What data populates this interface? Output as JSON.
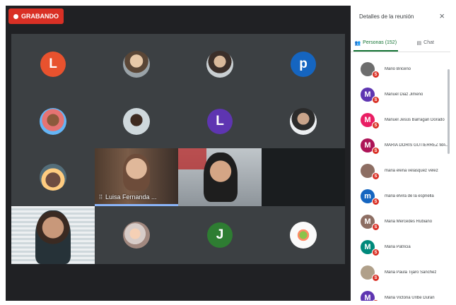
{
  "recording_label": "GRABANDO",
  "colors": {
    "accent_green": "#137333",
    "recording_red": "#d93025"
  },
  "grid": {
    "row1": [
      {
        "type": "letter",
        "letter": "L",
        "color": "#e8522e"
      },
      {
        "type": "photo",
        "icon": "person-photo"
      },
      {
        "type": "photo",
        "icon": "person-photo"
      },
      {
        "type": "letter",
        "letter": "p",
        "color": "#1565c0"
      }
    ],
    "row2": [
      {
        "type": "photo",
        "icon": "person-photo"
      },
      {
        "type": "photo",
        "icon": "person-photo"
      },
      {
        "type": "letter",
        "letter": "L",
        "color": "#5e35b1"
      },
      {
        "type": "photo",
        "icon": "person-photo"
      }
    ],
    "row3_speaker_name": "Luisa Fernanda ...",
    "row4_letter": {
      "letter": "J",
      "color": "#2e7d32"
    }
  },
  "panel": {
    "title": "Detalles de la reunión",
    "close": "×",
    "tab_people": "Personas (152)",
    "tab_chat": "Chat",
    "participants": [
      {
        "name": "Mario Briceño",
        "initial": "",
        "color": "#6d6d6d"
      },
      {
        "name": "Manuel Diaz Jimeno",
        "initial": "M",
        "color": "#5e35b1"
      },
      {
        "name": "Manuel Jesús Barragan Dorado",
        "initial": "M",
        "color": "#e91e63"
      },
      {
        "name": "MARIA DORIS GUTIERREZ MA...",
        "initial": "M",
        "color": "#ad1457"
      },
      {
        "name": "maria elena velasquez velez",
        "initial": "",
        "color": "#8d6e63"
      },
      {
        "name": "maria elvira de la espriella",
        "initial": "m",
        "color": "#1565c0"
      },
      {
        "name": "Maria Mercedes Rubiano",
        "initial": "M",
        "color": "#8d6e63"
      },
      {
        "name": "Maria Patricia",
        "initial": "M",
        "color": "#00897b"
      },
      {
        "name": "Maria Paula Tijaro Sanchez",
        "initial": "",
        "color": "#b0a08a"
      },
      {
        "name": "Maria Victoria Uribe Durán",
        "initial": "M",
        "color": "#5e35b1"
      }
    ]
  }
}
